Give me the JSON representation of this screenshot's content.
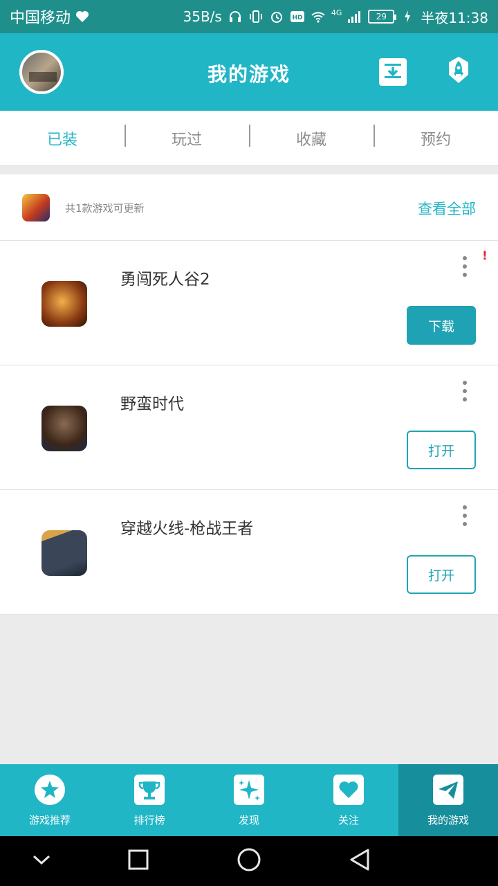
{
  "status_bar": {
    "carrier": "中国移动",
    "speed": "35B/s",
    "network": "4G",
    "battery": "29",
    "time": "半夜11:38"
  },
  "app_bar": {
    "title": "我的游戏"
  },
  "tabs": [
    {
      "label": "已装",
      "active": true
    },
    {
      "label": "玩过",
      "active": false
    },
    {
      "label": "收藏",
      "active": false
    },
    {
      "label": "预约",
      "active": false
    }
  ],
  "update_bar": {
    "text": "共1款游戏可更新",
    "link": "查看全部"
  },
  "games": [
    {
      "name": "勇闯死人谷2",
      "action": "下载",
      "action_style": "filled",
      "alert": "!"
    },
    {
      "name": "野蛮时代",
      "action": "打开",
      "action_style": "outline"
    },
    {
      "name": "穿越火线-枪战王者",
      "action": "打开",
      "action_style": "outline"
    }
  ],
  "bottom_nav": [
    {
      "label": "游戏推荐",
      "icon": "star-icon"
    },
    {
      "label": "排行榜",
      "icon": "trophy-icon"
    },
    {
      "label": "发现",
      "icon": "sparkle-icon"
    },
    {
      "label": "关注",
      "icon": "heart-icon"
    },
    {
      "label": "我的游戏",
      "icon": "paper-plane-icon",
      "active": true
    }
  ],
  "colors": {
    "status_bar": "#1f8f8c",
    "primary": "#21b6c6",
    "button": "#1fa3b4",
    "nav_active": "#168e9b"
  }
}
